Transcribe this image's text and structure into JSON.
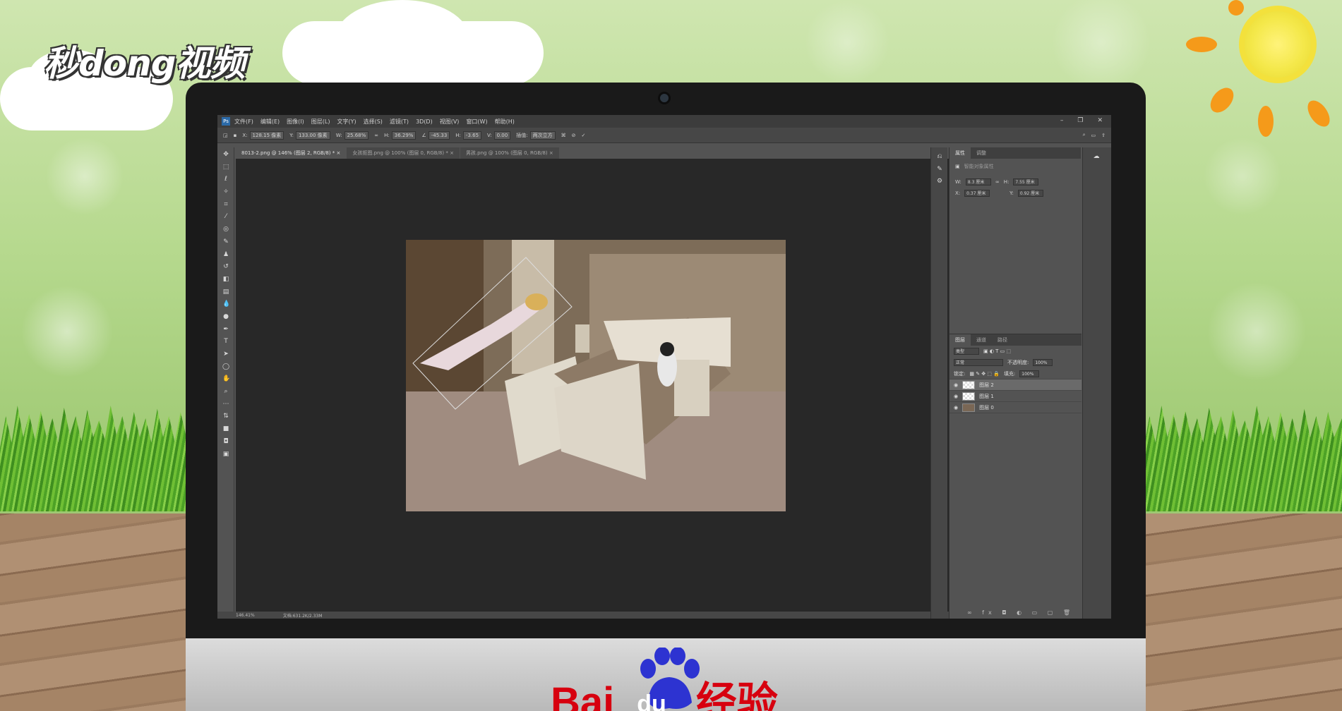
{
  "brand_top": "秒dong视频",
  "brand_bottom": "Bai du 经验",
  "brand_bottom_parts": {
    "bai": "Bai",
    "du": "du",
    "jingyan": "经验"
  },
  "menu": [
    "文件(F)",
    "编辑(E)",
    "图像(I)",
    "图层(L)",
    "文字(Y)",
    "选择(S)",
    "滤镜(T)",
    "3D(D)",
    "视图(V)",
    "窗口(W)",
    "帮助(H)"
  ],
  "options": {
    "x": "128.15 像素",
    "y": "133.00 像素",
    "w": "25.68%",
    "h": "36.29%",
    "angle": "-45.33",
    "hskew": "-3.65",
    "vskew": "0.00",
    "interp_label": "插值:",
    "interp": "两次立方"
  },
  "tabs": [
    "8013-2.png @ 146% (图层 2, RGB/8) *",
    "女孩抠图.png @ 100% (图层 0, RGB/8) *",
    "男孩.png @ 100% (图层 0, RGB/8)"
  ],
  "properties": {
    "tab_props": "属性",
    "tab_adjust": "调整",
    "title": "智能对象属性",
    "w": "8.3 厘米",
    "h": "7.55 厘米",
    "x": "0.37 厘米",
    "y": "0.92 厘米"
  },
  "layers_panel": {
    "tabs": [
      "图层",
      "通道",
      "路径"
    ],
    "kind": "类型",
    "blend": "正常",
    "opacity_label": "不透明度:",
    "opacity": "100%",
    "lock_label": "锁定:",
    "fill_label": "填充:",
    "fill": "100%"
  },
  "layers": [
    {
      "name": "图层 2",
      "selected": true
    },
    {
      "name": "图层 1",
      "selected": false
    },
    {
      "name": "图层 0",
      "selected": false
    }
  ],
  "status": {
    "zoom": "146.41%",
    "doc": "文档:631.2K/2.33M"
  },
  "colors": {
    "baidu_red": "#d7000f",
    "baidu_blue": "#2d33d1",
    "ps_bg": "#535353",
    "canvas": "#282828"
  }
}
